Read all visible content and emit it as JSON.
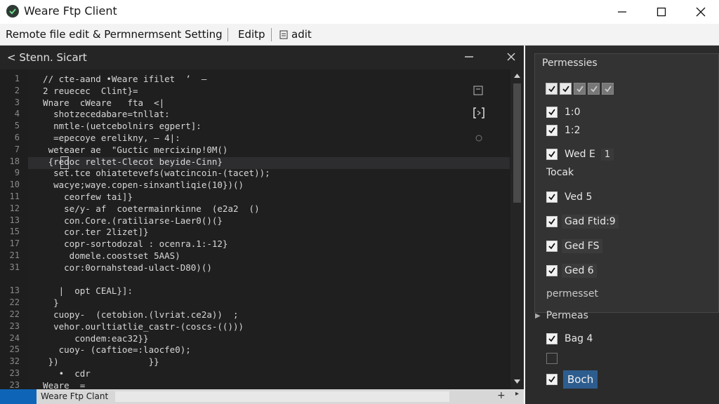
{
  "window": {
    "title": "Weare Ftp Client",
    "controls": [
      "minimize",
      "maximize",
      "close"
    ]
  },
  "menubar": {
    "items": [
      {
        "label": "Remote file edit & Permnermsent Setting"
      },
      {
        "label": "Editp"
      },
      {
        "label": "adit"
      }
    ]
  },
  "editor": {
    "title": "< Stenn. Sicart",
    "line_numbers": [
      "1",
      "2",
      "3",
      "4",
      "5",
      "6",
      "7",
      "18",
      "9",
      "10",
      "11",
      "12",
      "13",
      "15",
      "17",
      "21",
      "31",
      "",
      "13",
      "22",
      "22",
      "23",
      "24",
      "25",
      "32",
      "23",
      "23"
    ],
    "code_lines": [
      "  // cte-aand •Weare ifilet  ’  —",
      "  2 reuecec  Clint}=",
      "  Wnare  cWeare   fta  <|",
      "    shotzecedabare=tnllat:",
      "    nmtle-(uetcebolnirs egpert]:",
      "    =epecoye erelikny, — 4|:",
      "   weteaer ae  \"Guctic mercixinp!0M()",
      "   {redoc reltet-Clecot beyide-Cinn}",
      "    set.tce ohiatetevefs(watcincoin-(tacet));",
      "    wacye;waye.copen-sinxantliqie(10})()",
      "      ceorfew tai]}",
      "      se/y- af  coetermainrkinne  (e2a2  ()",
      "      con.Core.(ratiliarse-Laer0()(}",
      "      cor.ter 2lizet]}",
      "      copr-sortodozal : ocenra.1:-12}",
      "       domele.coostset 5AAS)",
      "      cor:0ornahstead-ulact-D80)()",
      "",
      "     |  opt CEAL}]:",
      "    }",
      "    cuopy-  (cetobion.(lvriat.ce2a))  ;",
      "    vehor.ourltiatlie_castr-(coscs-(()))",
      "        condem:eac32}}",
      "     cuoy- (caftioe=:laocfe0);",
      "   })                 }}",
      "     •  cdr",
      "  Weare  ="
    ]
  },
  "statusbar": {
    "text": "Weare Ftp Clant",
    "plus": "+",
    "arrow": "▸"
  },
  "permissions_panel": {
    "title": "Permessies",
    "top_checks": [
      true,
      true,
      false,
      false,
      false
    ],
    "rows": [
      {
        "label": "1:0",
        "checked": true
      },
      {
        "label": "1:2",
        "checked": true
      },
      {
        "label": "Wed E",
        "checked": true,
        "badge": "1"
      },
      {
        "label": "Ved 5",
        "checked": true
      },
      {
        "label": "Gad Ftid:9",
        "checked": true
      },
      {
        "label": "Ged FS",
        "checked": true
      },
      {
        "label": "Ged 6",
        "checked": true
      }
    ],
    "free_label": "Tocak",
    "footer": "permesset"
  },
  "permas_section": {
    "label": "Permeas",
    "rows": [
      {
        "label": "Bag 4",
        "checked": true
      },
      {
        "label": "",
        "checked": false
      },
      {
        "label": "Boch",
        "checked": true
      }
    ]
  },
  "colors": {
    "editor_bg": "#1e1e1e",
    "panel_bg": "#2b2b2b",
    "accent_blue": "#0e65b8",
    "button_blue": "#2d5d8f"
  }
}
